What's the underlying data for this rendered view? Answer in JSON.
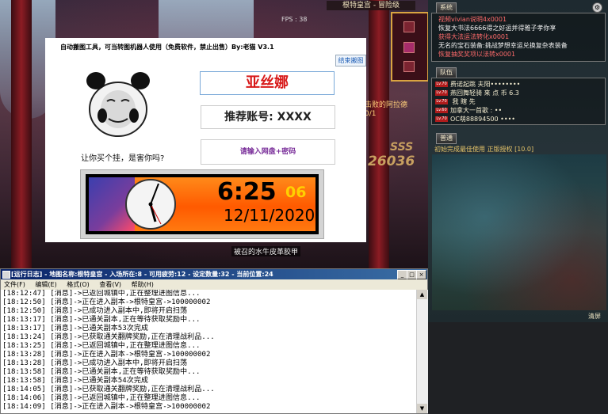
{
  "game": {
    "fps": "FPS : 38",
    "map_title": "根特皇宫 - 冒险级",
    "side_text_1": "击败的阿拉德",
    "side_text_2": "0/1",
    "rank": "SSS",
    "score": "26036",
    "npc_label": "被召的水牛皮革胶甲"
  },
  "tool": {
    "title": "自动搬图工具，可当转图机器人使用（免费软件，禁止出售）By:老猫     V3.1",
    "end_button": "结束搬图",
    "character_name": "亚丝娜",
    "referrer": "推荐账号: XXXX",
    "cloud_hint": "请输入网盘+密码",
    "caption": "让你买个挂，是害你吗?",
    "clock_time": "6:25",
    "clock_seconds": "06",
    "clock_date": "12/11/2020"
  },
  "right_panel": {
    "system_tab": "系统",
    "system_lines": [
      {
        "text": "视频vivian说明4x0001",
        "color": "#ff6b6b"
      },
      {
        "text": "恢复大书法6666得之好运并得雅子孝你享",
        "color": "#f0f0f0"
      },
      {
        "text": "获得大法运法转化x0001",
        "color": "#ff6b6b"
      },
      {
        "text": "无名的宝石装备:挑战梦想幸运兑换复杂表装备",
        "color": "#f0f0f0"
      },
      {
        "text": "恢复抽奖奖项以法转x0001",
        "color": "#ff6b6b"
      }
    ],
    "party_tab": "队伍",
    "party_lines": [
      {
        "lv": "Lv.70",
        "text": "费诺起跳 夫阳••••••••"
      },
      {
        "lv": "Lv.70",
        "text": "燕回舞轻骑 来 点 币        6.3"
      },
      {
        "lv": "Lv.70",
        "text": "                 我 瞎 先"
      },
      {
        "lv": "Lv.60",
        "text": "加拿大一首歌 : ••"
      },
      {
        "lv": "Lv.70",
        "text": "OC萌88894500 ••••"
      }
    ],
    "chat_tab": "普通",
    "chat_line": "初始完成最佳使用 正版授权 [10.0]",
    "clear_button": "清屏"
  },
  "log_window": {
    "title": "[运行日志] - 地图名称:根特皇宫 - 入场所在:8 - 可用疲劳:12 - 设定数量:32 - 当前位置:24",
    "menu": [
      "文件(F)",
      "编辑(E)",
      "格式(O)",
      "查看(V)",
      "帮助(H)"
    ],
    "lines": [
      "[18:12:47] [消息]->已返回城镇中,正在整理进图信息...",
      "[18:12:50] [消息]->正在进入副本->根特皇宫->100000002",
      "[18:12:50] [消息]->已成功进入副本中,即将开启扫荡",
      "[18:13:17] [消息]->已通关副本,正在等待获取奖励中...",
      "[18:13:17] [消息]->已通关副本53次完成",
      "[18:13:24] [消息]->已获取通关翻牌奖励,正在清理战利品...",
      "[18:13:25] [消息]->已返回城镇中,正在整理进图信息...",
      "[18:13:28] [消息]->正在进入副本->根特皇宫->100000002",
      "[18:13:28] [消息]->已成功进入副本中,即将开启扫荡",
      "[18:13:58] [消息]->已通关副本,正在等待获取奖励中...",
      "[18:13:58] [消息]->已通关副本54次完成",
      "[18:14:05] [消息]->已获取通关翻牌奖励,正在清理战利品...",
      "[18:14:06] [消息]->已返回城镇中,正在整理进图信息...",
      "[18:14:09] [消息]->正在进入副本->根特皇宫->100000002"
    ]
  },
  "colors": {
    "name_red": "#d81a1a",
    "log_titlebar": "#0a246a",
    "clock_orange": "#ff6a00"
  }
}
